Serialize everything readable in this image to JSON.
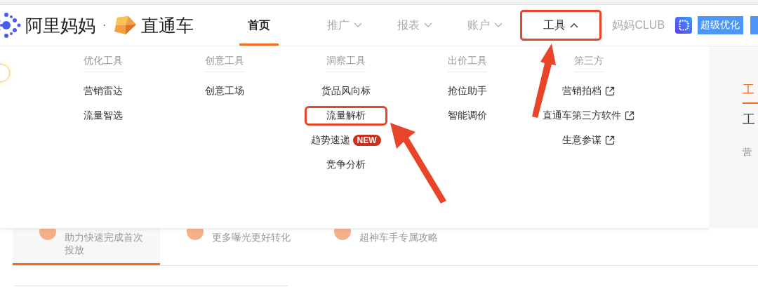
{
  "logo": {
    "brand": "阿里妈妈",
    "separator": "·",
    "product": "直通车"
  },
  "nav": [
    {
      "label": "首页",
      "kind": "plain",
      "selected": true,
      "expanded": false,
      "highlighted": false
    },
    {
      "label": "推广",
      "kind": "menu",
      "selected": false,
      "expanded": false,
      "highlighted": false
    },
    {
      "label": "报表",
      "kind": "menu",
      "selected": false,
      "expanded": false,
      "highlighted": false
    },
    {
      "label": "账户",
      "kind": "menu",
      "selected": false,
      "expanded": false,
      "highlighted": false
    },
    {
      "label": "工具",
      "kind": "menu",
      "selected": false,
      "expanded": true,
      "highlighted": true
    },
    {
      "label": "妈妈CLUB",
      "kind": "plain",
      "selected": false,
      "expanded": false,
      "highlighted": false
    }
  ],
  "action_button": {
    "label": "超级优化"
  },
  "menu_columns": [
    {
      "heading": "优化工具",
      "items": [
        {
          "label": "营销雷达",
          "external": false,
          "highlighted": false
        },
        {
          "label": "流量智选",
          "external": false,
          "highlighted": false
        }
      ]
    },
    {
      "heading": "创意工具",
      "items": [
        {
          "label": "创意工场",
          "external": false,
          "highlighted": false
        }
      ]
    },
    {
      "heading": "洞察工具",
      "items": [
        {
          "label": "货品风向标",
          "external": false,
          "highlighted": false
        },
        {
          "label": "流量解析",
          "external": false,
          "highlighted": true
        },
        {
          "label": "趋势速递",
          "external": false,
          "highlighted": false,
          "badge": "NEW"
        },
        {
          "label": "竞争分析",
          "external": false,
          "highlighted": false
        }
      ]
    },
    {
      "heading": "出价工具",
      "items": [
        {
          "label": "抢位助手",
          "external": false,
          "highlighted": false
        },
        {
          "label": "智能调价",
          "external": false,
          "highlighted": false
        }
      ]
    },
    {
      "heading": "第三方",
      "items": [
        {
          "label": "营销拍档",
          "external": true,
          "highlighted": false
        },
        {
          "label": "直通车第三方软件",
          "external": true,
          "highlighted": false
        },
        {
          "label": "生意参谋",
          "external": true,
          "highlighted": false
        }
      ]
    }
  ],
  "side_panel": {
    "tab": "工",
    "title": "工",
    "text": "营"
  },
  "tabs": [
    {
      "label": "助力快速完成首次投放",
      "selected": true
    },
    {
      "label": "更多曝光更好转化",
      "selected": false
    },
    {
      "label": "超神车手专属攻略",
      "selected": false
    }
  ]
}
